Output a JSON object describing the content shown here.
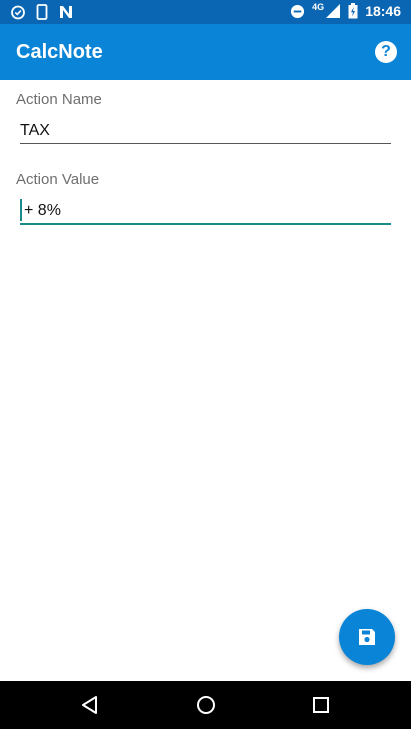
{
  "status_bar": {
    "time": "18:46",
    "network_label": "4G",
    "icons": [
      "alarm-clock-icon",
      "phone-outline-icon",
      "n-icon",
      "do-not-disturb-icon",
      "signal-icon",
      "battery-icon"
    ]
  },
  "app_bar": {
    "title": "CalcNote",
    "help_icon": "help-circle-icon"
  },
  "form": {
    "action_name": {
      "label": "Action Name",
      "value": "TAX"
    },
    "action_value": {
      "label": "Action Value",
      "value": "+ 8%"
    }
  },
  "fab": {
    "icon": "save-icon"
  },
  "nav_bar": {
    "icons": [
      "back-icon",
      "home-icon",
      "recents-icon"
    ]
  },
  "colors": {
    "status_bar": "#0a66b3",
    "primary": "#0a84d6",
    "focus_accent": "#1a8a8a",
    "nav_bar": "#000000"
  }
}
